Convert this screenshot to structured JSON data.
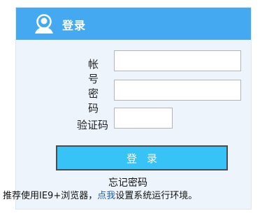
{
  "header": {
    "title": "登录",
    "icon": "user-icon"
  },
  "form": {
    "account_label": "帐号",
    "password_label": "密码",
    "captcha_label": "验证码",
    "account_value": "",
    "password_value": "",
    "captcha_value": ""
  },
  "actions": {
    "login_label": "登录",
    "forgot_label": "忘记密码"
  },
  "notice": {
    "prefix": "推荐使用IE9+浏览器，",
    "link": "点我",
    "suffix": "设置系统运行环境。"
  },
  "colors": {
    "header_bg": "#45a9f2",
    "panel_bg": "#eef4fc",
    "button_bg": "#38c3f6",
    "link": "#1f5dc5"
  }
}
